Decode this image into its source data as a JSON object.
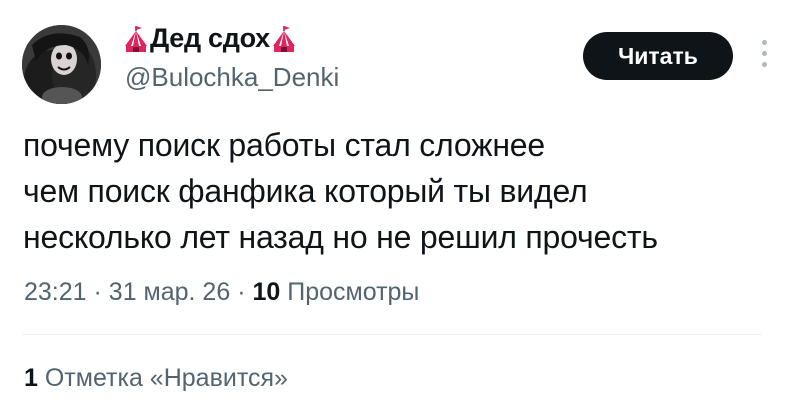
{
  "author": {
    "display_name": "Дед сдох",
    "handle": "@Bulochka_Denki",
    "name_emoji": "circus-tent-icon"
  },
  "actions": {
    "read_label": "Читать",
    "more": "more-vertical-icon"
  },
  "tweet": {
    "lines": [
      "почему поиск работы стал сложнее",
      "чем поиск фанфика который ты видел",
      "несколько лет назад но не решил прочесть"
    ],
    "time": "23:21",
    "date": "31 мар. 26",
    "separator": "·",
    "views_count": "10",
    "views_label": "Просмотры",
    "likes_count": "1",
    "likes_label": "Отметка «Нравится»"
  },
  "colors": {
    "text": "#0f1419",
    "secondary": "#536471",
    "button_bg": "#0f1419",
    "tent_red": "#e0245e",
    "divider": "#eff3f4"
  }
}
